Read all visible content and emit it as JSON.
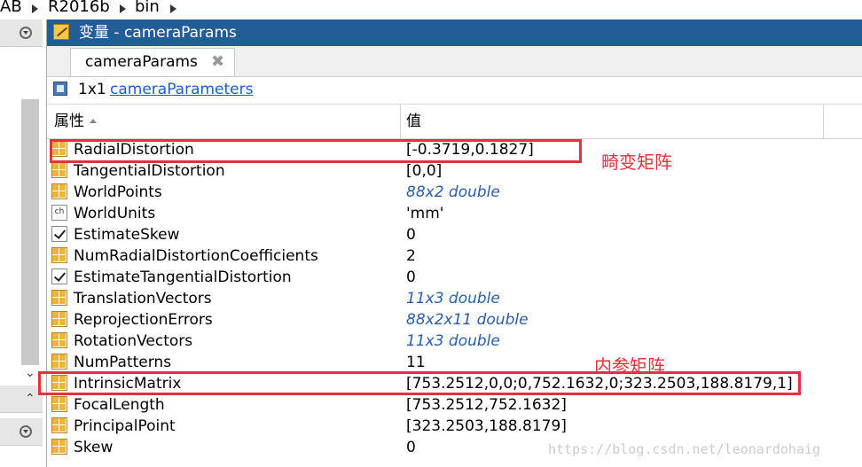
{
  "breadcrumb": [
    "AB",
    "R2016b",
    "bin"
  ],
  "window": {
    "title": "变量 - cameraParams"
  },
  "tab": {
    "label": "cameraParams",
    "close": "✖"
  },
  "info": {
    "size": "1x1",
    "class_link": "cameraParameters"
  },
  "columns": {
    "property": "属性",
    "value": "值"
  },
  "rows": [
    {
      "name": "RadialDistortion",
      "value": "[-0.3719,0.1827]",
      "icon": "grid-icon"
    },
    {
      "name": "TangentialDistortion",
      "value": "[0,0]",
      "icon": "grid-icon"
    },
    {
      "name": "WorldPoints",
      "value": "88x2 double",
      "icon": "grid-icon"
    },
    {
      "name": "WorldUnits",
      "value": "'mm'",
      "icon": "char-icon"
    },
    {
      "name": "EstimateSkew",
      "value": "0",
      "icon": "checkbox-icon"
    },
    {
      "name": "NumRadialDistortionCoefficients",
      "value": "2",
      "icon": "grid-icon"
    },
    {
      "name": "EstimateTangentialDistortion",
      "value": "0",
      "icon": "checkbox-icon"
    },
    {
      "name": "TranslationVectors",
      "value": "11x3 double",
      "icon": "grid-icon"
    },
    {
      "name": "ReprojectionErrors",
      "value": "88x2x11 double",
      "icon": "grid-icon"
    },
    {
      "name": "RotationVectors",
      "value": "11x3 double",
      "icon": "grid-icon"
    },
    {
      "name": "NumPatterns",
      "value": "11",
      "icon": "grid-icon"
    },
    {
      "name": "IntrinsicMatrix",
      "value": "[753.2512,0,0;0,752.1632,0;323.2503,188.8179,1]",
      "icon": "grid-icon"
    },
    {
      "name": "FocalLength",
      "value": "[753.2512,752.1632]",
      "icon": "grid-icon"
    },
    {
      "name": "PrincipalPoint",
      "value": "[323.2503,188.8179]",
      "icon": "grid-icon"
    },
    {
      "name": "Skew",
      "value": "0",
      "icon": "grid-icon"
    }
  ],
  "annotations": {
    "distortion": "畸变矩阵",
    "intrinsic": "内参矩阵"
  },
  "watermark": "https://blog.csdn.net/leonardohaig",
  "colors": {
    "titlebar": "#235d98",
    "annotation": "#e0333e",
    "link": "#1a5fc8"
  }
}
